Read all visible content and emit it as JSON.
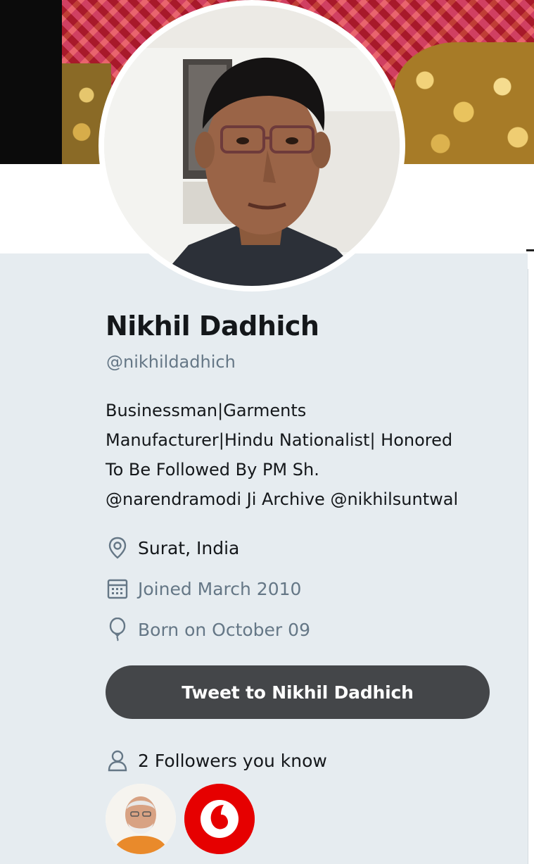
{
  "profile": {
    "name": "Nikhil Dadhich",
    "handle": "@nikhildadhich",
    "bio_lines": [
      "Businessman|Garments",
      "Manufacturer|Hindu Nationalist| Honored",
      "To Be Followed By PM Sh.",
      "@narendramodi Ji Archive @nikhilsuntwal"
    ],
    "location": "Surat, India",
    "joined": "Joined March 2010",
    "birthday": "Born on October 09"
  },
  "actions": {
    "tweet_to_label": "Tweet to Nikhil Dadhich"
  },
  "followers_you_know": {
    "label": "2 Followers you know",
    "avatars": [
      "narendra-modi-avatar",
      "vodafone-avatar"
    ]
  },
  "icons": {
    "location": "location-pin-icon",
    "joined": "calendar-icon",
    "birthday": "balloon-icon",
    "followers": "person-icon"
  },
  "colors": {
    "card_background": "#e6ecf0",
    "primary_text": "#14171a",
    "secondary_text": "#657786",
    "button_background": "#444649",
    "button_text": "#ffffff",
    "vodafone_red": "#e60000"
  }
}
